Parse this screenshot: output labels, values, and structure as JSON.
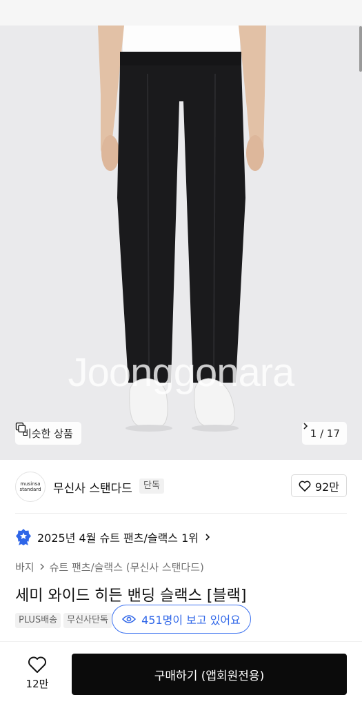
{
  "gallery": {
    "watermark": "Joonggonara",
    "similar_label": "비슷한 상품",
    "page_counter": "1 / 17"
  },
  "brand": {
    "logo_line1": "musinsa",
    "logo_line2": "standard",
    "name": "무신사 스탠다드",
    "badge": "단독",
    "likes": "92만"
  },
  "ranking": {
    "text": "2025년 4월 슈트 팬츠/슬랙스 1위"
  },
  "breadcrumb": {
    "root": "바지",
    "sub": "슈트 팬츠/슬랙스 (무신사 스탠다드)"
  },
  "product": {
    "title": "세미 와이드 히든 밴딩 슬랙스 [블랙]",
    "tags": [
      "PLUS배송",
      "무신사단독"
    ]
  },
  "viewers": {
    "text": "451명이 보고 있어요"
  },
  "bottom": {
    "favorite_count": "12만",
    "buy_label": "구매하기 (앱회원전용)"
  },
  "icons": [
    "copy-icon",
    "chevron-right-icon",
    "heart-icon",
    "rank-badge-icon",
    "eye-icon"
  ],
  "colors": {
    "accent_blue": "#2f66e8",
    "buy_button": "#0b0b0b",
    "hero_bg": "#eaeaec"
  }
}
